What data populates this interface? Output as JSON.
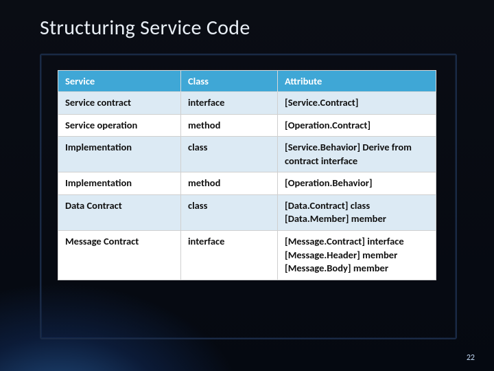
{
  "title": "Structuring Service Code",
  "page_number": "22",
  "table": {
    "headers": [
      "Service",
      "Class",
      "Attribute"
    ],
    "rows": [
      [
        "Service contract",
        "interface",
        "[Service.Contract]"
      ],
      [
        "Service operation",
        "method",
        "[Operation.Contract]"
      ],
      [
        "Implementation",
        "class",
        "[Service.Behavior] Derive from contract interface"
      ],
      [
        "Implementation",
        "method",
        "[Operation.Behavior]"
      ],
      [
        "Data Contract",
        "class",
        "[Data.Contract] class [Data.Member] member"
      ],
      [
        "Message Contract",
        "interface",
        "[Message.Contract] interface [Message.Header] member [Message.Body] member"
      ]
    ]
  }
}
